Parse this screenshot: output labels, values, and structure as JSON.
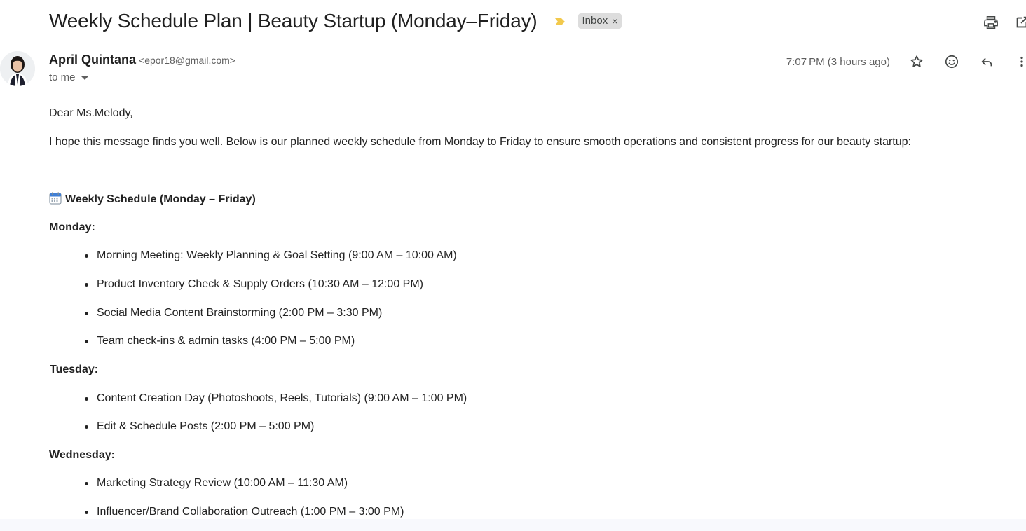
{
  "email": {
    "subject": "Weekly Schedule Plan | Beauty Startup (Monday–Friday)",
    "label": "Inbox",
    "label_close": "×",
    "sender_name": "April Quintana",
    "sender_email": "<epor18@gmail.com>",
    "recipient": "to me",
    "timestamp": "7:07 PM (3 hours ago)"
  },
  "icons": {
    "importance": "importance-marker-icon",
    "print": "print-icon",
    "popout": "open-in-new-window-icon",
    "star": "star-icon",
    "emoji": "emoji-reaction-icon",
    "reply": "reply-icon",
    "more": "more-vert-icon",
    "calendar": "calendar-emoji-icon"
  },
  "colors": {
    "importance": "#f2c94c",
    "label_chip": "#dddddd",
    "text": "#222222"
  },
  "body": {
    "greeting": "Dear Ms.Melody,",
    "intro": "I hope this message finds you well. Below is our planned weekly schedule from Monday to Friday to ensure smooth operations and consistent progress for our beauty startup:",
    "schedule_title": "Weekly Schedule (Monday – Friday)",
    "days": [
      {
        "day": "Monday:",
        "items": [
          "Morning Meeting: Weekly Planning & Goal Setting (9:00 AM – 10:00 AM)",
          "Product Inventory Check & Supply Orders (10:30 AM – 12:00 PM)",
          "Social Media Content Brainstorming (2:00 PM – 3:30 PM)",
          "Team check-ins & admin tasks (4:00 PM – 5:00 PM)"
        ]
      },
      {
        "day": "Tuesday:",
        "items": [
          "Content Creation Day (Photoshoots, Reels, Tutorials) (9:00 AM – 1:00 PM)",
          "Edit & Schedule Posts (2:00 PM – 5:00 PM)"
        ]
      },
      {
        "day": "Wednesday:",
        "items": [
          "Marketing Strategy Review (10:00 AM – 11:30 AM)",
          "Influencer/Brand Collaboration Outreach (1:00 PM – 3:00 PM)"
        ]
      }
    ]
  }
}
